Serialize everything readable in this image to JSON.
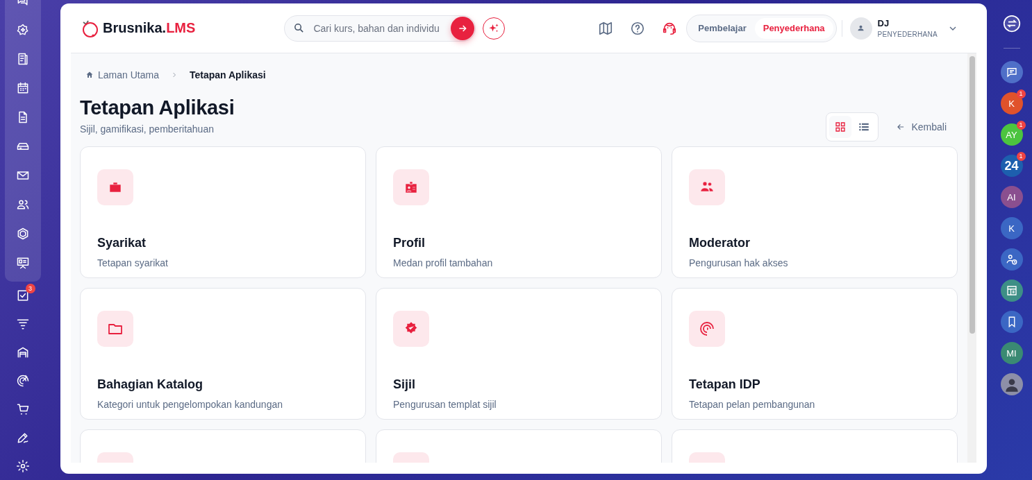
{
  "sidebar": {
    "items": [
      {
        "grouped": true
      },
      {
        "grouped": true
      },
      {
        "grouped": true
      },
      {
        "grouped": true
      },
      {
        "grouped": true
      },
      {
        "grouped": true
      },
      {
        "grouped": true
      },
      {
        "grouped": true
      },
      {
        "grouped": true
      },
      {
        "grouped": true
      },
      {
        "grouped": false,
        "badge": "3"
      },
      {
        "grouped": false
      },
      {
        "grouped": false
      },
      {
        "grouped": false
      },
      {
        "grouped": false
      },
      {
        "grouped": false
      },
      {
        "grouped": false
      }
    ]
  },
  "header": {
    "logo": {
      "name": "Brusnika.",
      "accent": "LMS"
    },
    "search": {
      "placeholder": "Cari kurs, bahan dan individu"
    },
    "roles": [
      {
        "label": "Pembelajar",
        "selected": false
      },
      {
        "label": "Penyederhana",
        "selected": true
      }
    ],
    "user": {
      "initials": "DJ",
      "role": "PENYEDERHANA"
    }
  },
  "breadcrumb": [
    {
      "label": "Laman Utama"
    },
    {
      "label": "Tetapan Aplikasi"
    }
  ],
  "page": {
    "title": "Tetapan Aplikasi",
    "subtitle": "Sijil, gamifikasi, pemberitahuan",
    "back": "Kembali"
  },
  "views": [
    {
      "selected": true
    },
    {
      "selected": false
    }
  ],
  "cards": [
    {
      "kind": "full",
      "title": "Syarikat",
      "description": "Tetapan syarikat"
    },
    {
      "kind": "full",
      "title": "Profil",
      "description": "Medan profil tambahan"
    },
    {
      "kind": "full",
      "title": "Moderator",
      "description": "Pengurusan hak akses"
    },
    {
      "kind": "full",
      "title": "Bahagian Katalog",
      "description": "Kategori untuk pengelompokan kandungan"
    },
    {
      "kind": "full",
      "title": "Sijil",
      "description": "Pengurusan templat sijil"
    },
    {
      "kind": "full",
      "title": "Tetapan IDP",
      "description": "Tetapan pelan pembangunan"
    },
    {
      "kind": "cut"
    },
    {
      "kind": "cut"
    },
    {
      "kind": "cut"
    }
  ],
  "rail": [
    {
      "kind": "icon",
      "color": "#4f6fc8"
    },
    {
      "kind": "text",
      "label": "K",
      "color": "#e0522b",
      "badge": "1"
    },
    {
      "kind": "text",
      "label": "AY",
      "color": "#4cc43f",
      "badge": "1"
    },
    {
      "kind": "text",
      "label": "24",
      "color": "#1d5fae",
      "badge": "1"
    },
    {
      "kind": "text",
      "label": "AI",
      "color": "#8a4f8f"
    },
    {
      "kind": "text",
      "label": "K",
      "color": "#3b67c4"
    },
    {
      "kind": "icon",
      "color": "#3b67c4"
    },
    {
      "kind": "icon",
      "color": "#3d8f86"
    },
    {
      "kind": "icon",
      "color": "#3b67c4"
    },
    {
      "kind": "text",
      "label": "MI",
      "color": "#3a8a73"
    },
    {
      "kind": "avatar",
      "color": "#8d8fa8"
    }
  ]
}
